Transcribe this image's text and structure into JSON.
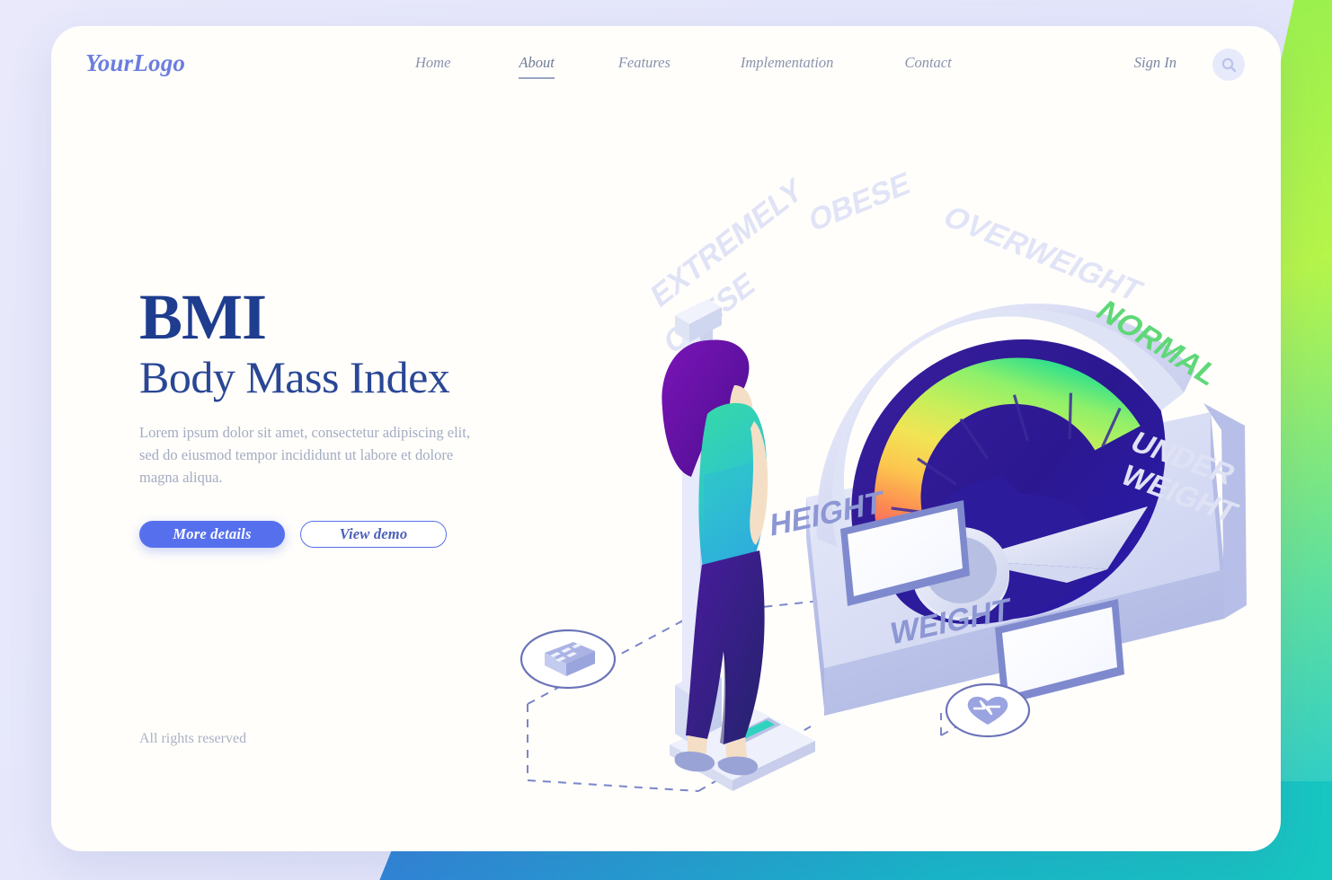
{
  "page": {
    "background_accent_green": "#9cf04e",
    "background_accent_blue": "#3b63e0",
    "background_accent_teal": "#16c3c3",
    "card_background": "#fffefb"
  },
  "header": {
    "logo": "YourLogo",
    "nav": [
      {
        "label": "Home",
        "active": false
      },
      {
        "label": "About",
        "active": true
      },
      {
        "label": "Features",
        "active": false
      },
      {
        "label": "Implementation",
        "active": false
      },
      {
        "label": "Contact",
        "active": false
      }
    ],
    "sign_in": "Sign In",
    "search_icon": "search-icon"
  },
  "hero": {
    "title": "BMI",
    "subtitle": "Body Mass Index",
    "paragraph": "Lorem ipsum dolor sit amet, consectetur adipiscing elit, sed do eiusmod tempor incididunt ut labore et dolore magna aliqua.",
    "primary_button": "More details",
    "secondary_button": "View demo",
    "title_color": "#1f3d8f",
    "primary_button_color": "#5670ed"
  },
  "footer": {
    "rights": "All rights reserved"
  },
  "illustration": {
    "name": "isometric-bmi-scale",
    "gauge_labels": [
      {
        "id": "extremely-obese",
        "text_line1": "EXTREMELY",
        "text_line2": "OBESE",
        "color": "#dfe2f5"
      },
      {
        "id": "obese",
        "text_line1": "OBESE",
        "text_line2": "",
        "color": "#dfe2f5"
      },
      {
        "id": "overweight",
        "text_line1": "OVERWEIGHT",
        "text_line2": "",
        "color": "#dfe2f5"
      },
      {
        "id": "normal",
        "text_line1": "NORMAL",
        "text_line2": "",
        "color": "#55d97a"
      },
      {
        "id": "under-weight",
        "text_line1": "UNDER",
        "text_line2": "WEIGHT",
        "color": "#dfe2f5"
      }
    ],
    "panel_labels": [
      {
        "id": "height",
        "text": "HEIGHT"
      },
      {
        "id": "weight",
        "text": "WEIGHT"
      }
    ],
    "icons": [
      {
        "id": "calculator-icon",
        "name": "calculator-icon"
      },
      {
        "id": "heart-pulse-icon",
        "name": "heart-pulse-icon"
      }
    ],
    "gauge_segment_colors": [
      "#f9556b",
      "#fd8a52",
      "#fcc64e",
      "#f2e455",
      "#c5ef5a",
      "#8ef06a",
      "#34e08b",
      "#2bd7c4",
      "#36bdf2"
    ],
    "gauge_rim_color": "#2e1a8f",
    "needle_color": "#eef0fb"
  }
}
